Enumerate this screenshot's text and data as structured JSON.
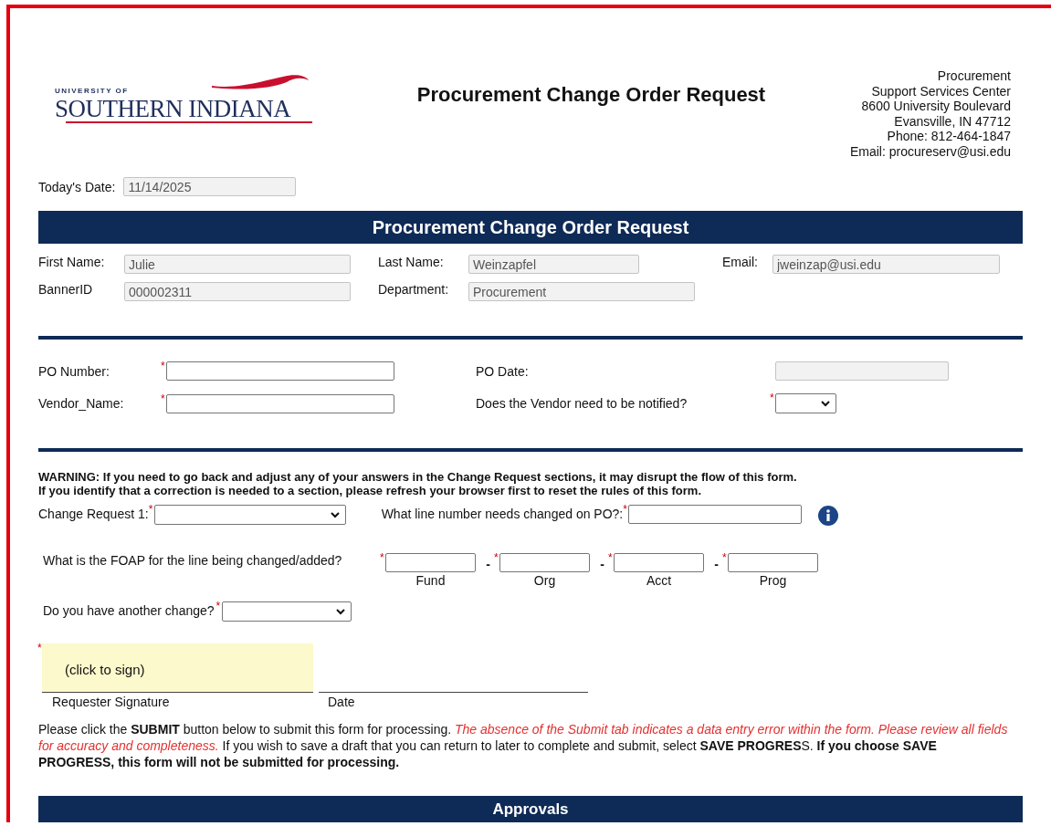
{
  "header": {
    "logo": {
      "small": "UNIVERSITY OF",
      "name": "SOUTHERN INDIANA"
    },
    "title": "Procurement Change Order Request",
    "address": [
      "Procurement",
      "Support Services Center",
      "8600 University Boulevard",
      "Evansville, IN 47712",
      "Phone: 812-464-1847",
      "Email: procureserv@usi.edu"
    ]
  },
  "todays_date": {
    "label": "Today's Date:",
    "value": "11/14/2025"
  },
  "banner": "Procurement Change Order Request",
  "requester": [
    {
      "label": "First Name:",
      "value": "Julie"
    },
    {
      "label": "Last Name:",
      "value": "Weinzapfel"
    },
    {
      "label": "Email:",
      "value": "jweinzap@usi.edu"
    },
    {
      "label": "BannerID",
      "value": "000002311"
    },
    {
      "label": "Department:",
      "value": "Procurement"
    }
  ],
  "po_fields": [
    {
      "label": "PO Number:",
      "kind": "text",
      "required_mark": "*"
    },
    {
      "label": "PO Date:",
      "kind": "readonly"
    },
    {
      "label": "Vendor_Name:",
      "kind": "text",
      "required_mark": "*"
    },
    {
      "label": "Does the Vendor need to be notified?",
      "kind": "select",
      "required_mark": "*"
    }
  ],
  "warning": [
    "WARNING: If you need to go back and adjust any of your answers in the Change Request sections, it may disrupt the flow of this form.",
    "If you identify that a correction is needed to a section, please refresh your browser first to reset the rules of this form."
  ],
  "change_request": {
    "label": "Change Request 1:",
    "required_mark": "*"
  },
  "line_number": {
    "label": "What line number needs changed on PO?:",
    "required_mark": "*"
  },
  "foap": {
    "label": "What is the FOAP for the line being changed/added?",
    "separator": "-",
    "parts": [
      {
        "label": "Fund",
        "required_mark": "*"
      },
      {
        "label": "Org",
        "required_mark": "*"
      },
      {
        "label": "Acct",
        "required_mark": "*"
      },
      {
        "label": "Prog",
        "required_mark": "*"
      }
    ]
  },
  "another_change": {
    "label": "Do you have another change?",
    "required_mark": "*"
  },
  "signature": {
    "placeholder": "(click to sign)",
    "required_mark": "*",
    "label": "Requester Signature",
    "date_label": "Date"
  },
  "note": "Please click the **SUBMIT** button below to submit this form for processing. *The absence of the Submit tab indicates a data entry error within the form. Please review all fields for accuracy and completeness.* If you wish to save a draft that you can return to later to complete and submit, select **SAVE PROGRES**S. **If you choose SAVE PROGRESS, this form will not be submitted for processing.**",
  "approvals": "Approvals"
}
